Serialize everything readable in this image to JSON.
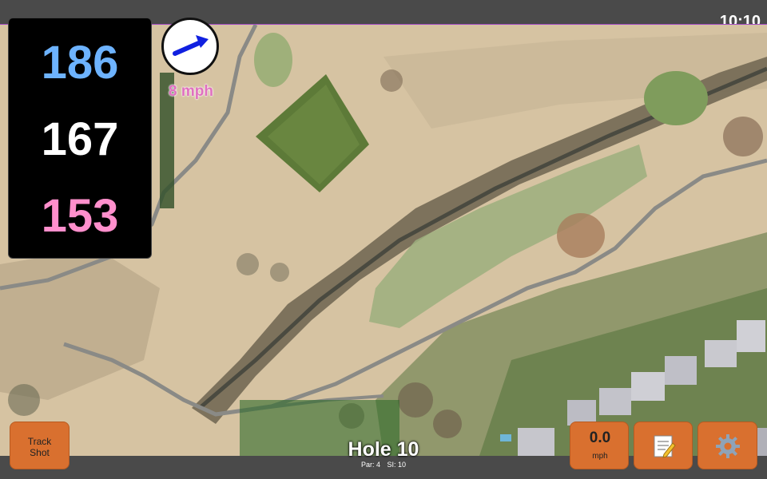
{
  "status": {
    "time": "10:10"
  },
  "distances": {
    "back": "186",
    "middle": "167",
    "front": "153"
  },
  "wind": {
    "speed_label": "8 mph",
    "arrow_icon": "wind-direction-arrow",
    "button_value": "0.0",
    "button_unit": "mph"
  },
  "hole": {
    "title": "Hole 10",
    "par": "Par: 4",
    "si": "SI: 10"
  },
  "buttons": {
    "track_line1": "Track",
    "track_line2": "Shot",
    "notes_icon": "notes-icon",
    "settings_icon": "gear-icon"
  },
  "colors": {
    "back": "#6db3ff",
    "middle": "#ffffff",
    "front": "#ff8fcc",
    "wind_label": "#e070c0",
    "button": "#d9702f",
    "arrow": "#1020e0"
  }
}
